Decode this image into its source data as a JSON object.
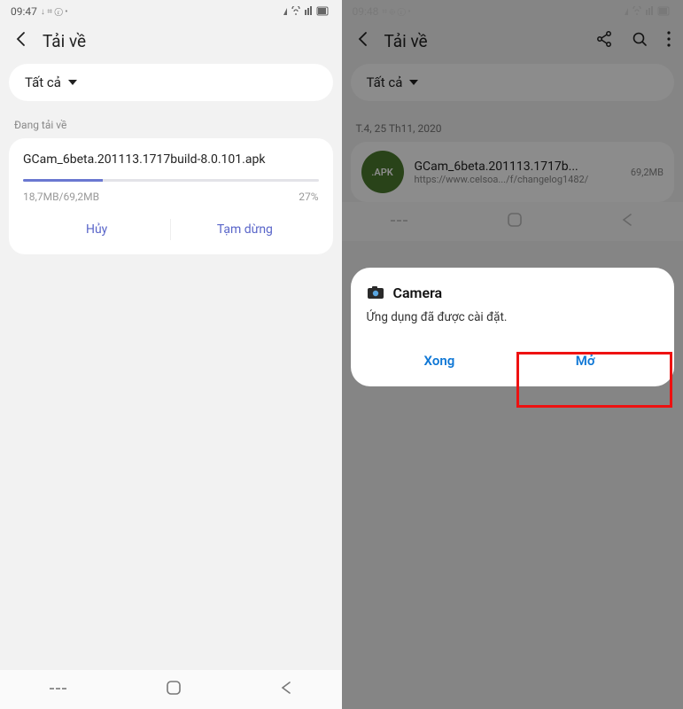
{
  "left": {
    "status": {
      "time": "09:47",
      "icons_left": "↓ ⌗ ⓡ •"
    },
    "title": "Tải về",
    "filter": "Tất cả",
    "downloading_label": "Đang tải về",
    "file_name": "GCam_6beta.201113.1717build-8.0.101.apk",
    "progress_pct": 27,
    "progress_text": "18,7MB/69,2MB",
    "progress_pct_text": "27%",
    "cancel": "Hủy",
    "pause": "Tạm dừng"
  },
  "right": {
    "status": {
      "time": "09:48",
      "icons_left": "⌗ ⊕ ⓡ •"
    },
    "title": "Tải về",
    "filter": "Tất cả",
    "date": "T.4, 25 Th11, 2020",
    "apk_label": ".APK",
    "file_name": "GCam_6beta.201113.1717b...",
    "file_src": "https://www.celsoa.../f/changelog1482/",
    "file_size": "69,2MB",
    "dialog": {
      "app": "Camera",
      "msg": "Ứng dụng đã được cài đặt.",
      "done": "Xong",
      "open": "Mở"
    }
  }
}
